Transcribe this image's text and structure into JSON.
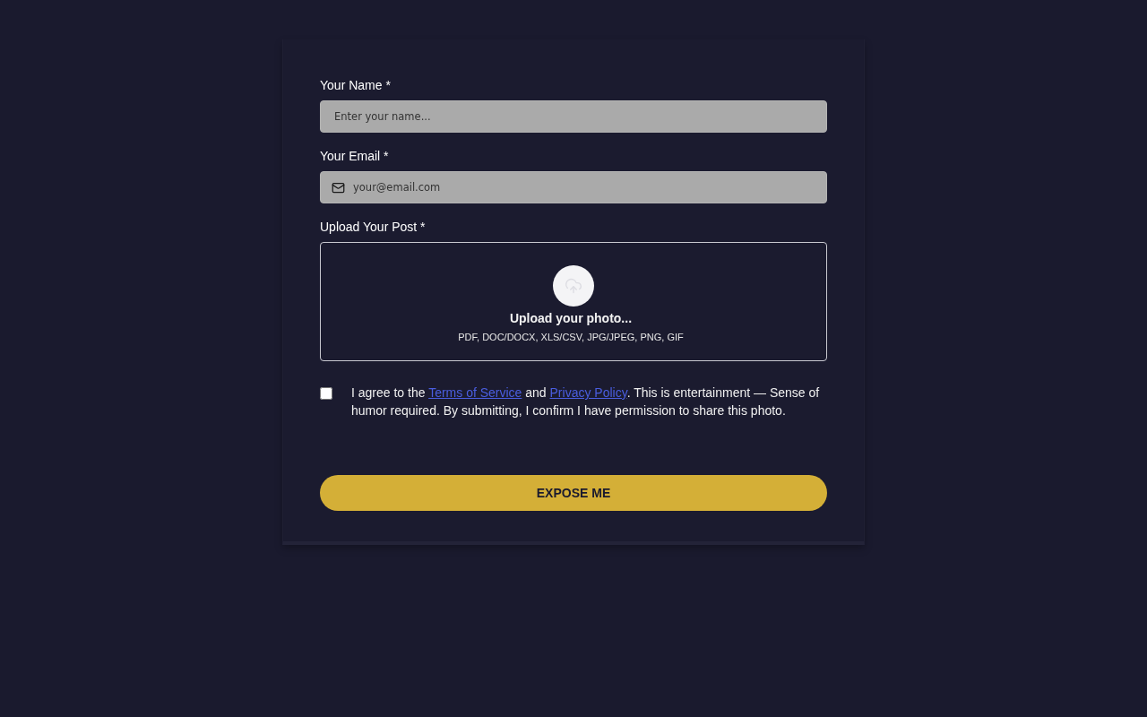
{
  "fields": [
    {
      "kind": "text",
      "label": "Your Name *",
      "placeholder": "Enter your name..."
    },
    {
      "kind": "email",
      "label": "Your Email *",
      "placeholder": "your@email.com"
    }
  ],
  "upload": {
    "label": "Upload Your Post *",
    "prompt": "Upload your photo...",
    "formats": "PDF, DOC/DOCX, XLS/CSV, JPG/JPEG, PNG, GIF"
  },
  "agreement": {
    "checked": false,
    "parts": [
      {
        "kind": "text",
        "text": "I agree to the "
      },
      {
        "kind": "link",
        "text": "Terms of Service"
      },
      {
        "kind": "text",
        "text": " and "
      },
      {
        "kind": "link",
        "text": "Privacy Policy"
      },
      {
        "kind": "text",
        "text": ". This is entertainment — Sense of humor required. By submitting, I confirm I have permission to share this photo."
      }
    ]
  },
  "submit": {
    "label": "EXPOSE ME"
  }
}
